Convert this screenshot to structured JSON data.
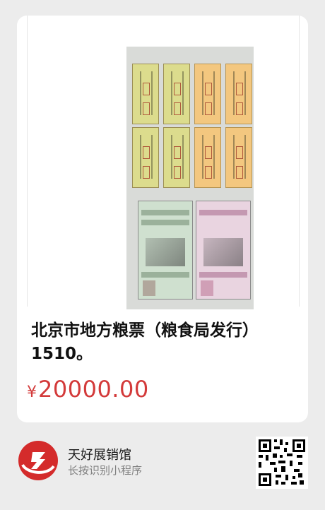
{
  "product": {
    "title": "北京市地方粮票（粮食局发行）1510。",
    "price_currency": "¥",
    "price_amount": "20000.00"
  },
  "shop": {
    "name": "天好展销馆",
    "subtitle": "长按识别小程序"
  },
  "colors": {
    "background": "#ececec",
    "card": "#ffffff",
    "price": "#d33a3a",
    "logo": "#d42b2b"
  },
  "icons": {
    "logo": "shop-logo-icon",
    "qr": "qr-code-icon"
  }
}
